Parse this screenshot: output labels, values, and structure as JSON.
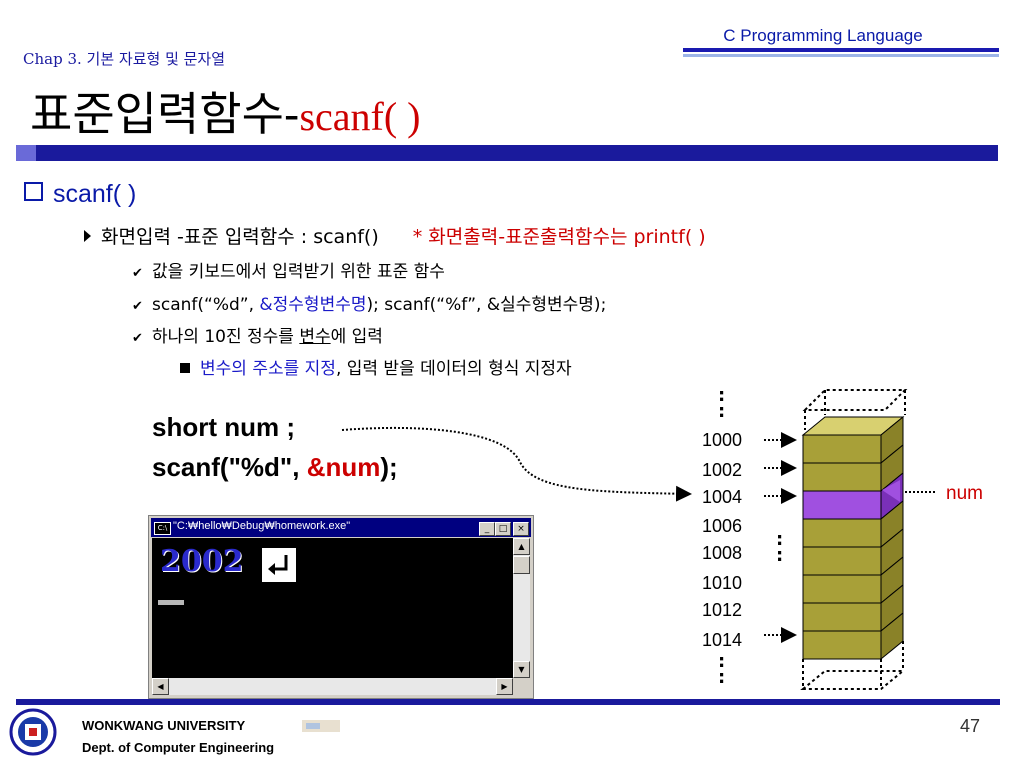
{
  "header": {
    "course": "C Programming Language",
    "chapter": "Chap 3. 기본 자료형 및 문자열",
    "title_main": "표준입력함수-",
    "title_sub": "scanf( )"
  },
  "bullets": {
    "level1": "scanf( )",
    "level2_black": "화면입력 -표준 입력함수 : scanf()",
    "level2_red": "* 화면출력-표준출력함수는 printf( )",
    "level3": [
      {
        "text": "값을 키보드에서 입력받기 위한 표준 함수"
      },
      {
        "pre": "scanf(“%d”, ",
        "blue": "&정수형변수명",
        "post": ");  scanf(“%f”, &실수형변수명);"
      },
      {
        "pre": "하나의 10진 정수를 ",
        "underline": "변수",
        "post": "에 입력"
      }
    ],
    "level4_blue": "변수의 주소를 지정",
    "level4_black": ", 입력 받을 데이터의 형식 지정자"
  },
  "code": {
    "line1": "short  num ;",
    "line2_pre": "scanf(\"%d\", ",
    "line2_amp": "&num",
    "line2_post": ");"
  },
  "console": {
    "title": "\"C:₩hello₩Debug₩homework.exe\"",
    "icon_label": "C:\\",
    "min_label": "_",
    "max_label": "□",
    "close_label": "×",
    "output": "2002"
  },
  "memory": {
    "addresses": [
      "1000",
      "1002",
      "1004",
      "1006",
      "1008",
      "1010",
      "1012",
      "1014"
    ],
    "highlight_index": 2,
    "highlight_label": "num",
    "colors": {
      "cell": "#a8a038",
      "highlight": "#a050e0",
      "text_red": "#cc0000"
    }
  },
  "footer": {
    "university": "WONKWANG UNIVERSITY",
    "department": "Dept. of Computer Engineering",
    "page": "47"
  },
  "colors": {
    "accent_blue": "#1a1a9c",
    "title_red": "#cc0000"
  }
}
